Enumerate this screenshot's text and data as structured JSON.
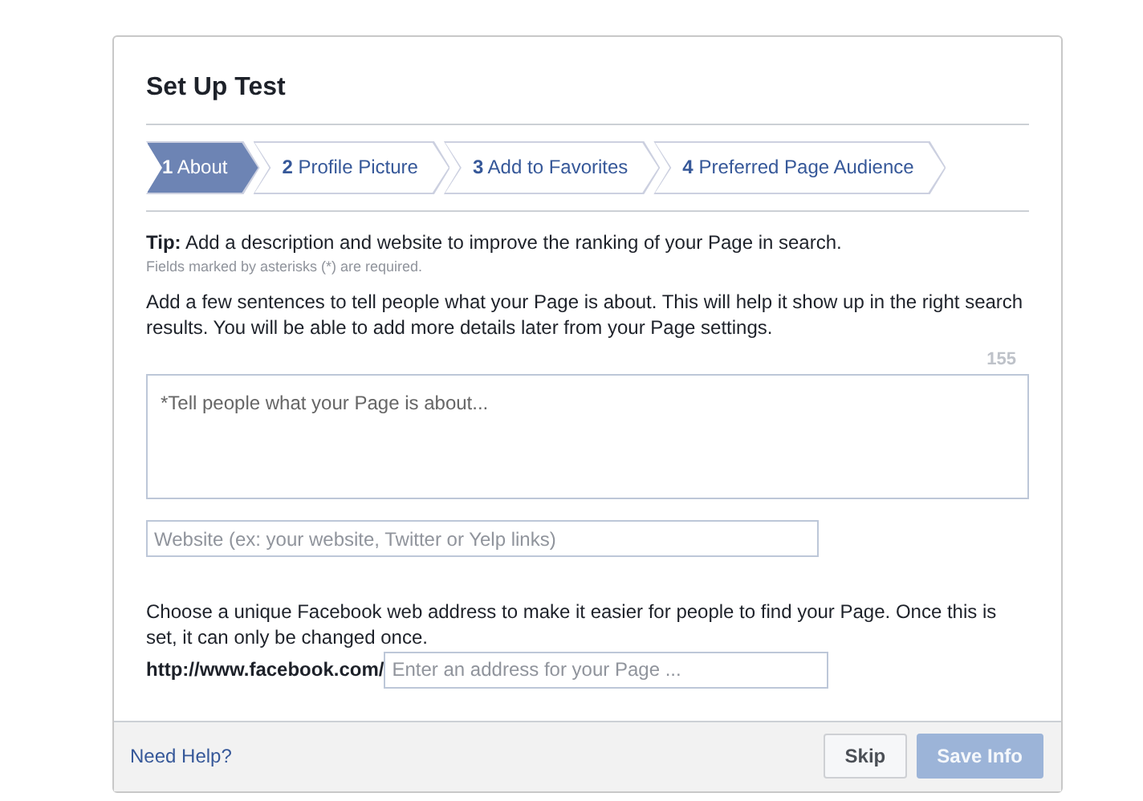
{
  "dialog": {
    "title": "Set Up Test"
  },
  "steps": [
    {
      "label": "**1** About",
      "selected": true
    },
    {
      "label": "**2** Profile Picture",
      "selected": false
    },
    {
      "label": "**3** Add to Favorites",
      "selected": false
    },
    {
      "label": "**4** Preferred Page Audience",
      "selected": false
    }
  ],
  "tip": "**Tip:** Add a description and website to improve the ranking of your Page in search.",
  "required_note": "Fields marked by asterisks (*) are required.",
  "about_intro": "Add a few sentences to tell people what your Page is about. This will help it show up in the right search results. You will be able to add more details later from your Page settings.",
  "char_count": "155",
  "about_field": {
    "placeholder": "*Tell people what your Page is about..."
  },
  "website_field": {
    "placeholder": "Website (ex: your website, Twitter or Yelp links)"
  },
  "address_intro": "Choose a unique Facebook web address to make it easier for people to find your Page. Once this is set, it can only be changed once.",
  "address_prefix": "http://www.facebook.com/",
  "address_field": {
    "placeholder": "Enter an address for your Page ..."
  },
  "footer": {
    "help_link": "Need Help?",
    "buttons": [
      {
        "label": "Skip",
        "kind": "secondary",
        "disabled": false
      },
      {
        "label": "Save Info",
        "kind": "primary",
        "disabled": true
      }
    ]
  }
}
